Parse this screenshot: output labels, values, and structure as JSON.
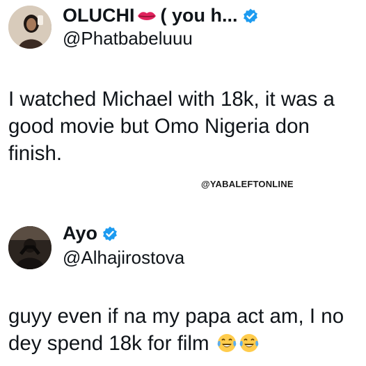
{
  "tweet1": {
    "display_name": "OLUCHI",
    "name_suffix": "( you h...",
    "handle": "@Phatbabeluuu",
    "text": "I watched Michael with 18k, it was a good movie but Omo Nigeria don finish."
  },
  "watermark": "@YABALEFTONLINE",
  "tweet2": {
    "display_name": "Ayo",
    "handle": "@Alhajirostova",
    "text": "guyy even if na my papa act am, I no dey spend 18k for film"
  },
  "icons": {
    "verified": "verified-badge-icon",
    "lips": "lips-emoji-icon",
    "laugh": "tears-of-joy-emoji-icon"
  },
  "colors": {
    "verified_blue": "#1d9bf0",
    "text": "#0f1419",
    "lips_red": "#e0245e"
  }
}
